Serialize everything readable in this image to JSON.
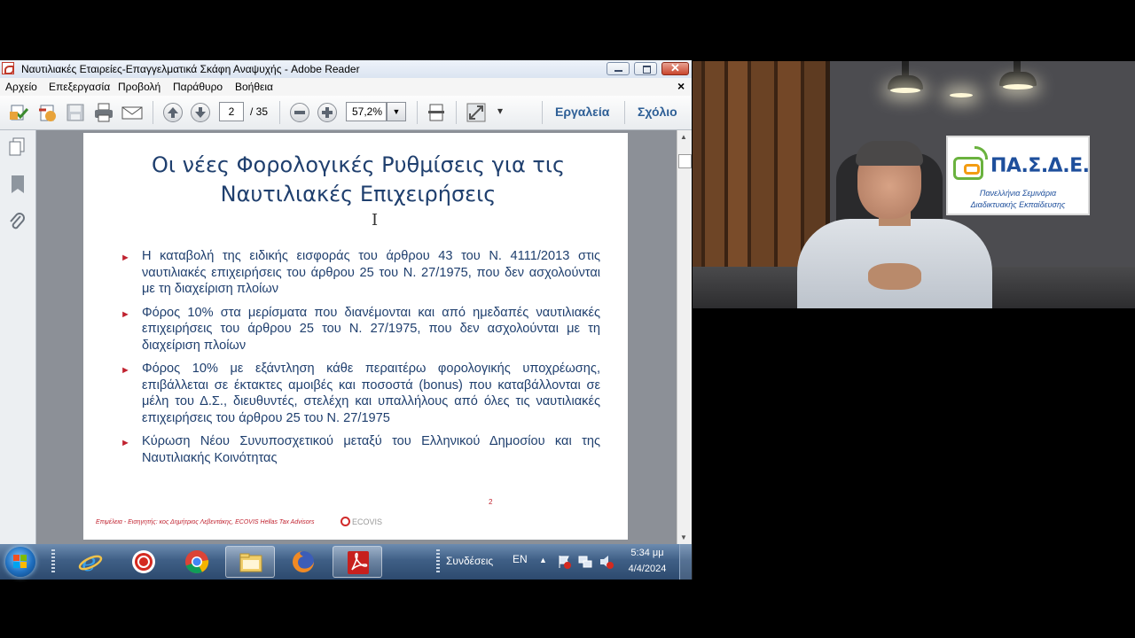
{
  "window": {
    "title": "Ναυτιλιακές Εταιρείες-Επαγγελματικά Σκάφη Αναψυχής - Adobe Reader",
    "close_glyph": "✕",
    "menu_close_glyph": "×"
  },
  "menu": {
    "items": [
      "Αρχείο",
      "Επεξεργασία",
      "Προβολή",
      "Παράθυρο",
      "Βοήθεια"
    ]
  },
  "toolbar": {
    "current_page": "2",
    "total_pages": "/ 35",
    "zoom": "57,2%",
    "zoom_drop_glyph": "▼",
    "more_glyph": "▾",
    "tools_label": "Εργαλεία",
    "comment_label": "Σχόλιο",
    "icons": [
      "create-pdf-icon",
      "edit-pdf-icon",
      "save-icon",
      "print-icon",
      "email-icon",
      "previous-page-icon",
      "next-page-icon",
      "zoom-out-icon",
      "zoom-in-icon",
      "fit-page-icon",
      "fullscreen-icon"
    ]
  },
  "sidebar": {
    "icons": [
      "pages-icon",
      "bookmarks-icon",
      "attachments-icon"
    ]
  },
  "slide": {
    "title_line1": "Οι νέες Φορολογικές Ρυθμίσεις για τις",
    "title_line2": "Ναυτιλιακές Επιχειρήσεις",
    "bullet_glyph": "►",
    "bullets": [
      "Η καταβολή της ειδικής εισφοράς του άρθρου 43 του Ν. 4111/2013 στις ναυτιλιακές επιχειρήσεις του άρθρου 25 του Ν. 27/1975, που δεν ασχολούνται με τη διαχείριση πλοίων",
      "Φόρος 10% στα μερίσματα που διανέμονται και από ημεδαπές ναυτιλιακές επιχειρήσεις του άρθρου 25 του Ν. 27/1975, που δεν ασχολούνται με τη διαχείριση πλοίων",
      "Φόρος 10% με εξάντληση κάθε περαιτέρω φορολογικής υποχρέωσης, επιβάλλεται σε έκτακτες αμοιβές και ποσοστά (bonus) που καταβάλλονται σε μέλη του Δ.Σ., διευθυντές, στελέχη και υπαλλήλους από όλες τις ναυτιλιακές επιχειρήσεις του άρθρου 25 του Ν. 27/1975",
      "Κύρωση Νέου Συνυποσχετικού μεταξύ του Ελληνικού Δημοσίου και της Ναυτιλιακής Κοινότητας"
    ],
    "page_number": "2",
    "footer": "Επιμέλεια - Εισηγητής: κος Δημήτριος Λεβεντάκης, ECOVIS Hellas Tax Advisors",
    "footer_logo": "ECOVIS",
    "text_cursor": "I"
  },
  "scrollbar": {
    "up_glyph": "▲",
    "down_glyph": "▼"
  },
  "taskbar": {
    "apps": [
      "internet-explorer-icon",
      "media-icon",
      "chrome-icon",
      "file-explorer-icon",
      "firefox-icon",
      "adobe-reader-icon"
    ],
    "tray_label": "Συνδέσεις",
    "language": "EN",
    "tray_arrow": "▲",
    "time": "5:34 μμ",
    "date": "4/4/2024"
  },
  "video": {
    "logo_name": "ΠΑ.Σ.Δ.Ε.",
    "logo_sub1": "Πανελλήνια Σεμινάρια",
    "logo_sub2": "Διαδικτυακής Εκπαίδευσης"
  },
  "colors": {
    "slide_text": "#1f3f6e",
    "bullet": "#c0222f",
    "link": "#2e5f96",
    "logo_blue": "#1e4f9c",
    "logo_green": "#6ab23e"
  }
}
